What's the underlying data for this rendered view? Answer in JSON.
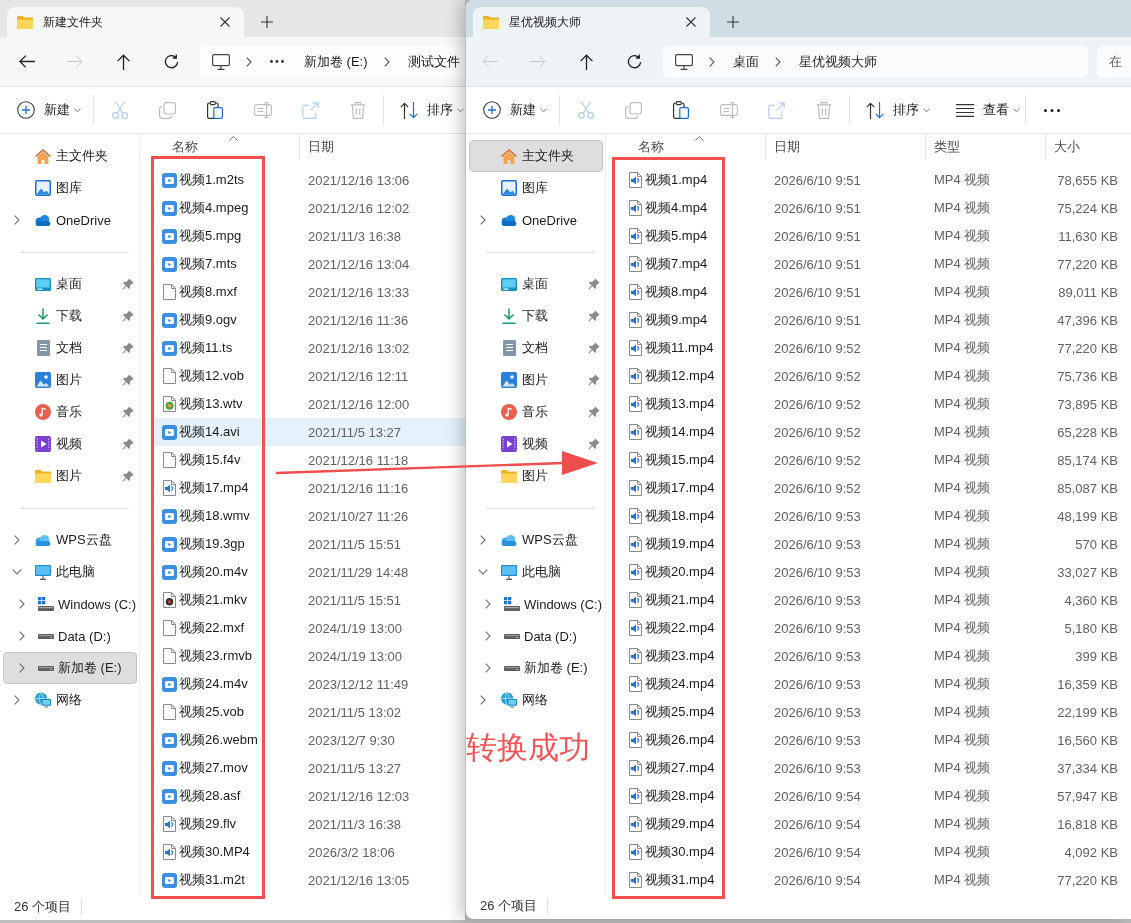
{
  "windows": [
    {
      "active": false,
      "tabs": [
        {
          "title": "新建文件夹",
          "selected": true
        }
      ],
      "nav": [
        {
          "kind": "back",
          "disabled": false
        },
        {
          "kind": "forward",
          "disabled": true
        },
        {
          "kind": "up",
          "disabled": false
        },
        {
          "kind": "refresh",
          "disabled": false
        }
      ],
      "address": {
        "collapsed": true,
        "segments": [
          "新加卷 (E:)",
          "测试文件"
        ]
      },
      "toolbar": [
        {
          "kind": "new",
          "label": "新建",
          "disabled": false
        },
        {
          "kind": "cut",
          "disabled": true
        },
        {
          "kind": "copy",
          "disabled": true
        },
        {
          "kind": "paste",
          "disabled": false
        },
        {
          "kind": "rename",
          "disabled": true
        },
        {
          "kind": "share",
          "disabled": true
        },
        {
          "kind": "delete",
          "disabled": true
        },
        {
          "kind": "sort",
          "label": "排序",
          "disabled": false
        }
      ],
      "sidebar": {
        "sections": [
          {
            "items": [
              {
                "label": "主文件夹",
                "kind": "home",
                "selected": false,
                "pinned": false
              },
              {
                "label": "图库",
                "kind": "gallery",
                "selected": false,
                "pinned": false
              },
              {
                "label": "OneDrive",
                "kind": "onedrive",
                "selected": false,
                "pinned": false,
                "expanded": false
              }
            ]
          },
          {
            "items": [
              {
                "label": "桌面",
                "kind": "desktop",
                "selected": false,
                "pinned": true
              },
              {
                "label": "下载",
                "kind": "downloads",
                "selected": false,
                "pinned": true
              },
              {
                "label": "文档",
                "kind": "documents",
                "selected": false,
                "pinned": true
              },
              {
                "label": "图片",
                "kind": "pictures",
                "selected": false,
                "pinned": true
              },
              {
                "label": "音乐",
                "kind": "music",
                "selected": false,
                "pinned": true
              },
              {
                "label": "视频",
                "kind": "videos",
                "selected": false,
                "pinned": true
              },
              {
                "label": "图片",
                "kind": "folder",
                "selected": false,
                "pinned": true
              }
            ]
          },
          {
            "items": [
              {
                "label": "WPS云盘",
                "kind": "wps",
                "selected": false,
                "pinned": false,
                "expanded": false
              },
              {
                "label": "此电脑",
                "kind": "pc",
                "selected": false,
                "pinned": false,
                "expanded": true,
                "children": [
                  {
                    "label": "Windows (C:)",
                    "kind": "system-drive",
                    "selected": false,
                    "pinned": false,
                    "expanded": false
                  },
                  {
                    "label": "Data (D:)",
                    "kind": "drive",
                    "selected": false,
                    "pinned": false,
                    "expanded": false
                  },
                  {
                    "label": "新加卷 (E:)",
                    "kind": "drive",
                    "selected": true,
                    "pinned": false,
                    "expanded": false
                  }
                ]
              },
              {
                "label": "网络",
                "kind": "network",
                "selected": false,
                "pinned": false,
                "expanded": false
              }
            ]
          }
        ]
      },
      "columns": [
        {
          "kind": "name",
          "label": "名称",
          "sorted": true
        },
        {
          "kind": "date",
          "label": "日期",
          "sorted": false
        }
      ],
      "files": [
        {
          "kind": "video",
          "selected": false,
          "cells": [
            "视频1.m2ts",
            "2021/12/16 13:06"
          ]
        },
        {
          "kind": "video",
          "selected": false,
          "cells": [
            "视频4.mpeg",
            "2021/12/16 12:02"
          ]
        },
        {
          "kind": "video",
          "selected": false,
          "cells": [
            "视频5.mpg",
            "2021/11/3 16:38"
          ]
        },
        {
          "kind": "video",
          "selected": false,
          "cells": [
            "视频7.mts",
            "2021/12/16 13:04"
          ]
        },
        {
          "kind": "blank",
          "selected": false,
          "cells": [
            "视频8.mxf",
            "2021/12/16 13:33"
          ]
        },
        {
          "kind": "video",
          "selected": false,
          "cells": [
            "视频9.ogv",
            "2021/12/16 11:36"
          ]
        },
        {
          "kind": "video",
          "selected": false,
          "cells": [
            "视频11.ts",
            "2021/12/16 13:02"
          ]
        },
        {
          "kind": "blank",
          "selected": false,
          "cells": [
            "视频12.vob",
            "2021/12/16 12:11"
          ]
        },
        {
          "kind": "tv",
          "selected": false,
          "cells": [
            "视频13.wtv",
            "2021/12/16 12:00"
          ]
        },
        {
          "kind": "video",
          "selected": true,
          "cells": [
            "视频14.avi",
            "2021/11/5 13:27"
          ]
        },
        {
          "kind": "blank",
          "selected": false,
          "cells": [
            "视频15.f4v",
            "2021/12/16 11:18"
          ]
        },
        {
          "kind": "media",
          "selected": false,
          "cells": [
            "视频17.mp4",
            "2021/12/16 11:16"
          ]
        },
        {
          "kind": "video",
          "selected": false,
          "cells": [
            "视频18.wmv",
            "2021/10/27 11:26"
          ]
        },
        {
          "kind": "video",
          "selected": false,
          "cells": [
            "视频19.3gp",
            "2021/11/5 15:51"
          ]
        },
        {
          "kind": "video",
          "selected": false,
          "cells": [
            "视频20.m4v",
            "2021/11/29 14:48"
          ]
        },
        {
          "kind": "disc",
          "selected": false,
          "cells": [
            "视频21.mkv",
            "2021/11/5 15:51"
          ]
        },
        {
          "kind": "blank",
          "selected": false,
          "cells": [
            "视频22.mxf",
            "2024/1/19 13:00"
          ]
        },
        {
          "kind": "blank",
          "selected": false,
          "cells": [
            "视频23.rmvb",
            "2024/1/19 13:00"
          ]
        },
        {
          "kind": "video",
          "selected": false,
          "cells": [
            "视频24.m4v",
            "2023/12/12 11:49"
          ]
        },
        {
          "kind": "blank",
          "selected": false,
          "cells": [
            "视频25.vob",
            "2021/11/5 13:02"
          ]
        },
        {
          "kind": "video",
          "selected": false,
          "cells": [
            "视频26.webm",
            "2023/12/7 9:30"
          ]
        },
        {
          "kind": "video",
          "selected": false,
          "cells": [
            "视频27.mov",
            "2021/11/5 13:27"
          ]
        },
        {
          "kind": "video",
          "selected": false,
          "cells": [
            "视频28.asf",
            "2021/12/16 12:03"
          ]
        },
        {
          "kind": "media",
          "selected": false,
          "cells": [
            "视频29.flv",
            "2021/11/3 16:38"
          ]
        },
        {
          "kind": "media",
          "selected": false,
          "cells": [
            "视频30.MP4",
            "2026/3/2 18:06"
          ]
        },
        {
          "kind": "video",
          "selected": false,
          "cells": [
            "视频31.m2t",
            "2021/12/16 13:05"
          ]
        }
      ],
      "status_bar": "26 个项目"
    },
    {
      "active": true,
      "tabs": [
        {
          "title": "星优视频大师",
          "selected": true
        }
      ],
      "nav": [
        {
          "kind": "back",
          "disabled": true
        },
        {
          "kind": "forward",
          "disabled": true
        },
        {
          "kind": "up",
          "disabled": false
        },
        {
          "kind": "refresh",
          "disabled": false
        }
      ],
      "address": {
        "collapsed": false,
        "segments": [
          "桌面",
          "星优视频大师"
        ]
      },
      "search": {
        "placeholder": "在"
      },
      "toolbar": [
        {
          "kind": "new",
          "label": "新建",
          "disabled": false
        },
        {
          "kind": "cut",
          "disabled": true
        },
        {
          "kind": "copy",
          "disabled": true
        },
        {
          "kind": "paste",
          "disabled": false
        },
        {
          "kind": "rename",
          "disabled": true
        },
        {
          "kind": "share",
          "disabled": true
        },
        {
          "kind": "delete",
          "disabled": true
        },
        {
          "kind": "sort",
          "label": "排序",
          "disabled": false
        },
        {
          "kind": "view",
          "label": "查看",
          "disabled": false
        },
        {
          "kind": "more",
          "disabled": false
        }
      ],
      "sidebar": {
        "sections": [
          {
            "items": [
              {
                "label": "主文件夹",
                "kind": "home",
                "selected": true,
                "pinned": false
              },
              {
                "label": "图库",
                "kind": "gallery",
                "selected": false,
                "pinned": false
              },
              {
                "label": "OneDrive",
                "kind": "onedrive",
                "selected": false,
                "pinned": false,
                "expanded": false
              }
            ]
          },
          {
            "items": [
              {
                "label": "桌面",
                "kind": "desktop",
                "selected": false,
                "pinned": true
              },
              {
                "label": "下载",
                "kind": "downloads",
                "selected": false,
                "pinned": true
              },
              {
                "label": "文档",
                "kind": "documents",
                "selected": false,
                "pinned": true
              },
              {
                "label": "图片",
                "kind": "pictures",
                "selected": false,
                "pinned": true
              },
              {
                "label": "音乐",
                "kind": "music",
                "selected": false,
                "pinned": true
              },
              {
                "label": "视频",
                "kind": "videos",
                "selected": false,
                "pinned": true
              },
              {
                "label": "图片",
                "kind": "folder",
                "selected": false,
                "pinned": false
              }
            ]
          },
          {
            "items": [
              {
                "label": "WPS云盘",
                "kind": "wps",
                "selected": false,
                "pinned": false,
                "expanded": false
              },
              {
                "label": "此电脑",
                "kind": "pc",
                "selected": false,
                "pinned": false,
                "expanded": true,
                "children": [
                  {
                    "label": "Windows (C:)",
                    "kind": "system-drive",
                    "selected": false,
                    "pinned": false,
                    "expanded": false
                  },
                  {
                    "label": "Data (D:)",
                    "kind": "drive",
                    "selected": false,
                    "pinned": false,
                    "expanded": false
                  },
                  {
                    "label": "新加卷 (E:)",
                    "kind": "drive",
                    "selected": false,
                    "pinned": false,
                    "expanded": false
                  }
                ]
              },
              {
                "label": "网络",
                "kind": "network",
                "selected": false,
                "pinned": false,
                "expanded": false
              }
            ]
          }
        ]
      },
      "columns": [
        {
          "kind": "name",
          "label": "名称",
          "sorted": true
        },
        {
          "kind": "date",
          "label": "日期",
          "sorted": false
        },
        {
          "kind": "type",
          "label": "类型",
          "sorted": false
        },
        {
          "kind": "size",
          "label": "大小",
          "sorted": false
        }
      ],
      "files": [
        {
          "kind": "media",
          "selected": false,
          "cells": [
            "视频1.mp4",
            "2026/6/10 9:51",
            "MP4 视频",
            "78,655 KB"
          ]
        },
        {
          "kind": "media",
          "selected": false,
          "cells": [
            "视频4.mp4",
            "2026/6/10 9:51",
            "MP4 视频",
            "75,224 KB"
          ]
        },
        {
          "kind": "media",
          "selected": false,
          "cells": [
            "视频5.mp4",
            "2026/6/10 9:51",
            "MP4 视频",
            "11,630 KB"
          ]
        },
        {
          "kind": "media",
          "selected": false,
          "cells": [
            "视频7.mp4",
            "2026/6/10 9:51",
            "MP4 视频",
            "77,220 KB"
          ]
        },
        {
          "kind": "media",
          "selected": false,
          "cells": [
            "视频8.mp4",
            "2026/6/10 9:51",
            "MP4 视频",
            "89,011 KB"
          ]
        },
        {
          "kind": "media",
          "selected": false,
          "cells": [
            "视频9.mp4",
            "2026/6/10 9:51",
            "MP4 视频",
            "47,396 KB"
          ]
        },
        {
          "kind": "media",
          "selected": false,
          "cells": [
            "视频11.mp4",
            "2026/6/10 9:52",
            "MP4 视频",
            "77,220 KB"
          ]
        },
        {
          "kind": "media",
          "selected": false,
          "cells": [
            "视频12.mp4",
            "2026/6/10 9:52",
            "MP4 视频",
            "75,736 KB"
          ]
        },
        {
          "kind": "media",
          "selected": false,
          "cells": [
            "视频13.mp4",
            "2026/6/10 9:52",
            "MP4 视频",
            "73,895 KB"
          ]
        },
        {
          "kind": "media",
          "selected": false,
          "cells": [
            "视频14.mp4",
            "2026/6/10 9:52",
            "MP4 视频",
            "65,228 KB"
          ]
        },
        {
          "kind": "media",
          "selected": false,
          "cells": [
            "视频15.mp4",
            "2026/6/10 9:52",
            "MP4 视频",
            "85,174 KB"
          ]
        },
        {
          "kind": "media",
          "selected": false,
          "cells": [
            "视频17.mp4",
            "2026/6/10 9:52",
            "MP4 视频",
            "85,087 KB"
          ]
        },
        {
          "kind": "media",
          "selected": false,
          "cells": [
            "视频18.mp4",
            "2026/6/10 9:53",
            "MP4 视频",
            "48,199 KB"
          ]
        },
        {
          "kind": "media",
          "selected": false,
          "cells": [
            "视频19.mp4",
            "2026/6/10 9:53",
            "MP4 视频",
            "570 KB"
          ]
        },
        {
          "kind": "media",
          "selected": false,
          "cells": [
            "视频20.mp4",
            "2026/6/10 9:53",
            "MP4 视频",
            "33,027 KB"
          ]
        },
        {
          "kind": "media",
          "selected": false,
          "cells": [
            "视频21.mp4",
            "2026/6/10 9:53",
            "MP4 视频",
            "4,360 KB"
          ]
        },
        {
          "kind": "media",
          "selected": false,
          "cells": [
            "视频22.mp4",
            "2026/6/10 9:53",
            "MP4 视频",
            "5,180 KB"
          ]
        },
        {
          "kind": "media",
          "selected": false,
          "cells": [
            "视频23.mp4",
            "2026/6/10 9:53",
            "MP4 视频",
            "399 KB"
          ]
        },
        {
          "kind": "media",
          "selected": false,
          "cells": [
            "视频24.mp4",
            "2026/6/10 9:53",
            "MP4 视频",
            "16,359 KB"
          ]
        },
        {
          "kind": "media",
          "selected": false,
          "cells": [
            "视频25.mp4",
            "2026/6/10 9:53",
            "MP4 视频",
            "22,199 KB"
          ]
        },
        {
          "kind": "media",
          "selected": false,
          "cells": [
            "视频26.mp4",
            "2026/6/10 9:53",
            "MP4 视频",
            "16,560 KB"
          ]
        },
        {
          "kind": "media",
          "selected": false,
          "cells": [
            "视频27.mp4",
            "2026/6/10 9:53",
            "MP4 视频",
            "37,334 KB"
          ]
        },
        {
          "kind": "media",
          "selected": false,
          "cells": [
            "视频28.mp4",
            "2026/6/10 9:54",
            "MP4 视频",
            "57,947 KB"
          ]
        },
        {
          "kind": "media",
          "selected": false,
          "cells": [
            "视频29.mp4",
            "2026/6/10 9:54",
            "MP4 视频",
            "16,818 KB"
          ]
        },
        {
          "kind": "media",
          "selected": false,
          "cells": [
            "视频30.mp4",
            "2026/6/10 9:54",
            "MP4 视频",
            "4,092 KB"
          ]
        },
        {
          "kind": "media",
          "selected": false,
          "cells": [
            "视频31.mp4",
            "2026/6/10 9:54",
            "MP4 视频",
            "77,220 KB"
          ]
        }
      ],
      "status_bar": "26 个项目"
    }
  ],
  "annotation": {
    "caption": "转换成功"
  }
}
